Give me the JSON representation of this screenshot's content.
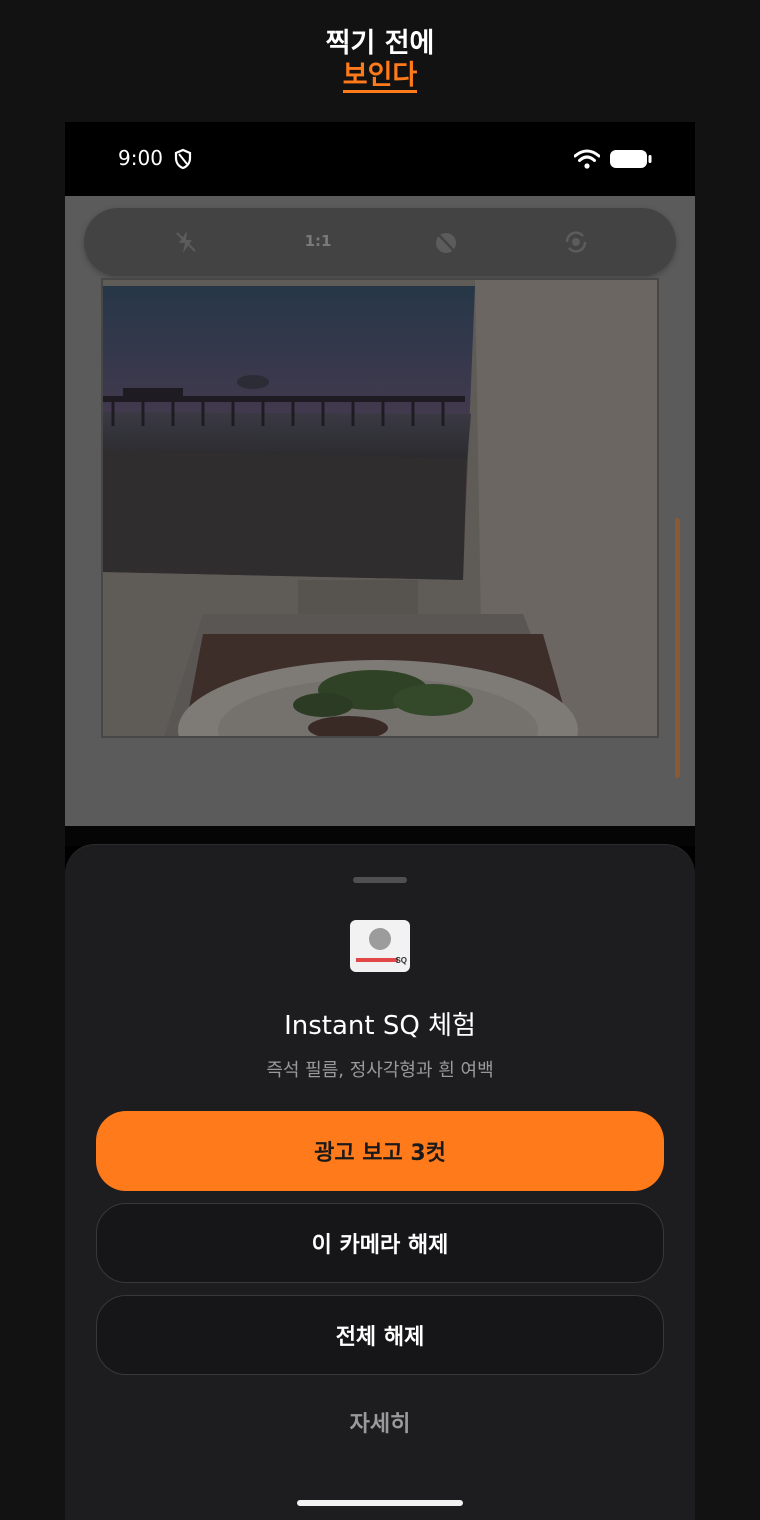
{
  "promo": {
    "line1": "찍기 전에",
    "line2": "보인다",
    "accent_color": "#ff7a1a"
  },
  "status_bar": {
    "time": "9:00",
    "icons": [
      "shield-icon",
      "wifi-icon",
      "battery-icon"
    ]
  },
  "camera_toolbar": {
    "flash_icon": "flash-off-icon",
    "aspect_ratio": "1:1",
    "timer_icon": "timer-off-icon",
    "flip_icon": "flip-camera-icon"
  },
  "sheet": {
    "film_icon": "instant-sq-film-icon",
    "film_icon_tag": "SQ",
    "title": "Instant SQ 체험",
    "subtitle": "즉석 필름, 정사각형과 흰 여백",
    "primary_button": "광고 보고 3컷",
    "unlock_camera_button": "이 카메라 해제",
    "unlock_all_button": "전체 해제",
    "details_link": "자세히"
  }
}
